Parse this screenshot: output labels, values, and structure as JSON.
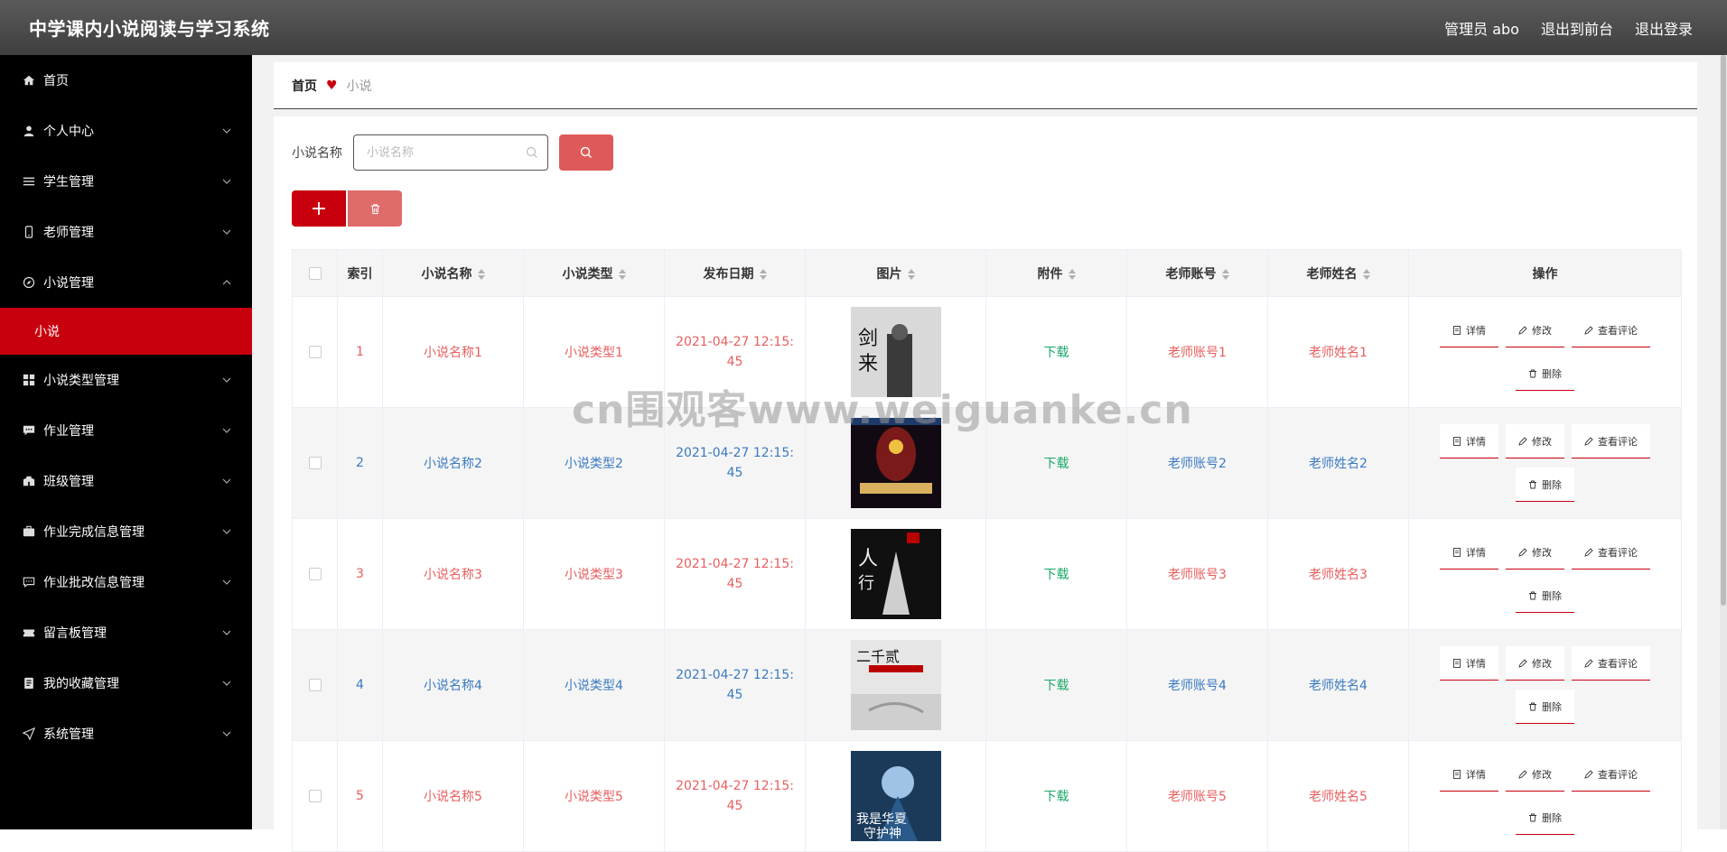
{
  "header": {
    "title": "中学课内小说阅读与学习系统",
    "admin_label": "管理员 abo",
    "front_label": "退出到前台",
    "logout_label": "退出登录"
  },
  "sidebar": {
    "items": [
      {
        "label": "首页",
        "icon": "home-icon"
      },
      {
        "label": "个人中心",
        "icon": "user-icon"
      },
      {
        "label": "学生管理",
        "icon": "list-icon"
      },
      {
        "label": "老师管理",
        "icon": "mobile-icon"
      },
      {
        "label": "小说管理",
        "icon": "compass-icon",
        "expanded": true
      },
      {
        "label": "小说类型管理",
        "icon": "grid-icon"
      },
      {
        "label": "作业管理",
        "icon": "message-icon"
      },
      {
        "label": "班级管理",
        "icon": "school-icon"
      },
      {
        "label": "作业完成信息管理",
        "icon": "briefcase-icon"
      },
      {
        "label": "作业批改信息管理",
        "icon": "chat-icon"
      },
      {
        "label": "留言板管理",
        "icon": "ticket-icon"
      },
      {
        "label": "我的收藏管理",
        "icon": "notebook-icon"
      },
      {
        "label": "系统管理",
        "icon": "send-icon"
      }
    ],
    "active_sub": "小说"
  },
  "breadcrumb": {
    "home": "首页",
    "current": "小说"
  },
  "search": {
    "label": "小说名称",
    "placeholder": "小说名称"
  },
  "table": {
    "headers": [
      "索引",
      "小说名称",
      "小说类型",
      "发布日期",
      "图片",
      "附件",
      "老师账号",
      "老师姓名",
      "操作"
    ],
    "rows": [
      {
        "index": "1",
        "name": "小说名称1",
        "type": "小说类型1",
        "date": "2021-04-27 12:15:45",
        "attachment": "下载",
        "account": "老师账号1",
        "teacher": "老师姓名1"
      },
      {
        "index": "2",
        "name": "小说名称2",
        "type": "小说类型2",
        "date": "2021-04-27 12:15:45",
        "attachment": "下载",
        "account": "老师账号2",
        "teacher": "老师姓名2"
      },
      {
        "index": "3",
        "name": "小说名称3",
        "type": "小说类型3",
        "date": "2021-04-27 12:15:45",
        "attachment": "下载",
        "account": "老师账号3",
        "teacher": "老师姓名3"
      },
      {
        "index": "4",
        "name": "小说名称4",
        "type": "小说类型4",
        "date": "2021-04-27 12:15:45",
        "attachment": "下载",
        "account": "老师账号4",
        "teacher": "老师姓名4"
      },
      {
        "index": "5",
        "name": "小说名称5",
        "type": "小说类型5",
        "date": "2021-04-27 12:15:45",
        "attachment": "下载",
        "account": "老师账号5",
        "teacher": "老师姓名5"
      }
    ],
    "ops": {
      "detail": "详情",
      "edit": "修改",
      "comments": "查看评论",
      "delete": "删除"
    }
  },
  "watermark": "cn围观客www.weiguanke.cn",
  "colors": {
    "accent": "#c8000d",
    "sidebar": "#000000",
    "header": "#4a4a4a"
  }
}
